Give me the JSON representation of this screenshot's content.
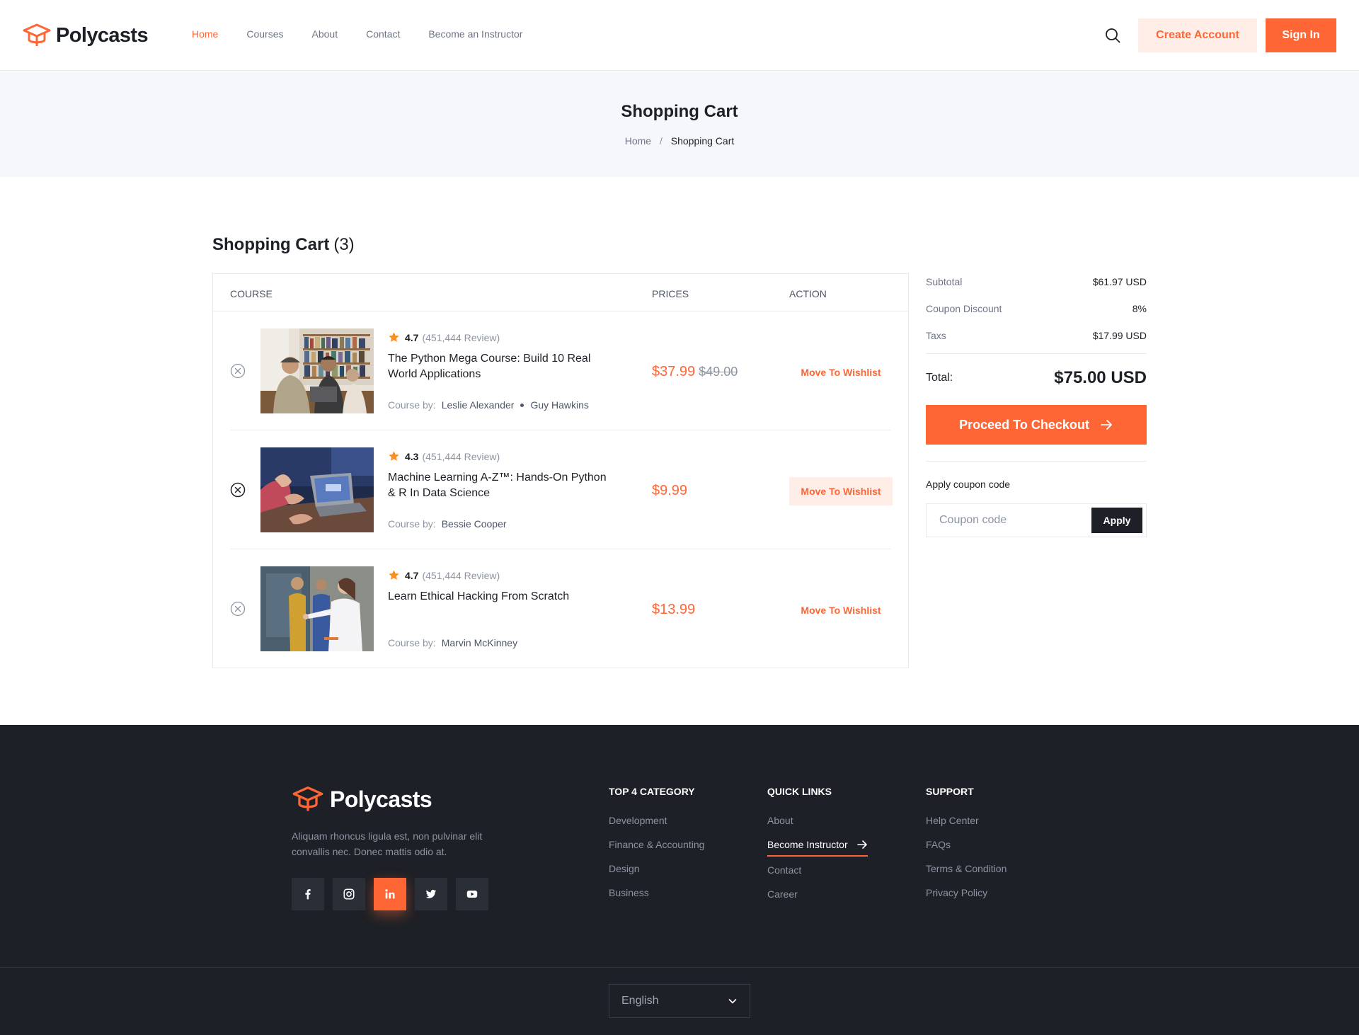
{
  "brand": {
    "name": "Polycasts",
    "accent": "#ff6636",
    "dark": "#1d2026"
  },
  "nav": {
    "items": [
      {
        "label": "Home",
        "active": true
      },
      {
        "label": "Courses",
        "active": false
      },
      {
        "label": "About",
        "active": false
      },
      {
        "label": "Contact",
        "active": false
      },
      {
        "label": "Become an Instructor",
        "active": false
      }
    ],
    "create_account": "Create Account",
    "sign_in": "Sign In"
  },
  "page": {
    "title": "Shopping Cart",
    "breadcrumb": {
      "home": "Home",
      "separator": "/",
      "current": "Shopping Cart"
    }
  },
  "cart": {
    "heading": "Shopping Cart",
    "count": "(3)",
    "columns": {
      "course": "Course",
      "prices": "Prices",
      "action": "Action"
    },
    "items": [
      {
        "rating": "4.7",
        "reviews": "(451,444 Review)",
        "title": "The Python Mega Course: Build 10 Real World Applications",
        "by_label": "Course by:",
        "instructors": [
          "Leslie Alexander",
          "Guy Hawkins"
        ],
        "price": "$37.99",
        "old_price": "$49.00",
        "action": "Move To Wishlist"
      },
      {
        "rating": "4.3",
        "reviews": "(451,444 Review)",
        "title": "Machine Learning A-Z™: Hands-On Python & R In Data Science",
        "by_label": "Course by:",
        "instructors": [
          "Bessie Cooper"
        ],
        "price": "$9.99",
        "old_price": "",
        "action": "Move To Wishlist"
      },
      {
        "rating": "4.7",
        "reviews": "(451,444 Review)",
        "title": "Learn Ethical Hacking From Scratch",
        "by_label": "Course by:",
        "instructors": [
          "Marvin McKinney"
        ],
        "price": "$13.99",
        "old_price": "",
        "action": "Move To Wishlist"
      }
    ]
  },
  "summary": {
    "subtotal_label": "Subtotal",
    "subtotal": "$61.97 USD",
    "coupon_label": "Coupon Discount",
    "coupon": "8%",
    "taxes_label": "Taxs",
    "taxes": "$17.99 USD",
    "total_label": "Total:",
    "total": "$75.00 USD",
    "checkout": "Proceed To Checkout",
    "apply_label": "Apply coupon code",
    "coupon_placeholder": "Coupon code",
    "apply_button": "Apply"
  },
  "footer": {
    "description": "Aliquam rhoncus ligula est, non pulvinar elit convallis nec. Donec mattis odio at.",
    "socials": [
      "facebook-icon",
      "instagram-icon",
      "linkedin-icon",
      "twitter-icon",
      "youtube-icon"
    ],
    "categories_title": "Top 4 Category",
    "categories": [
      "Development",
      "Finance & Accounting",
      "Design",
      "Business"
    ],
    "quick_title": "Quick Links",
    "quick": [
      "About",
      "Become Instructor",
      "Contact",
      "Career"
    ],
    "support_title": "Support",
    "support": [
      "Help Center",
      "FAQs",
      "Terms & Condition",
      "Privacy Policy"
    ],
    "language": "English"
  }
}
